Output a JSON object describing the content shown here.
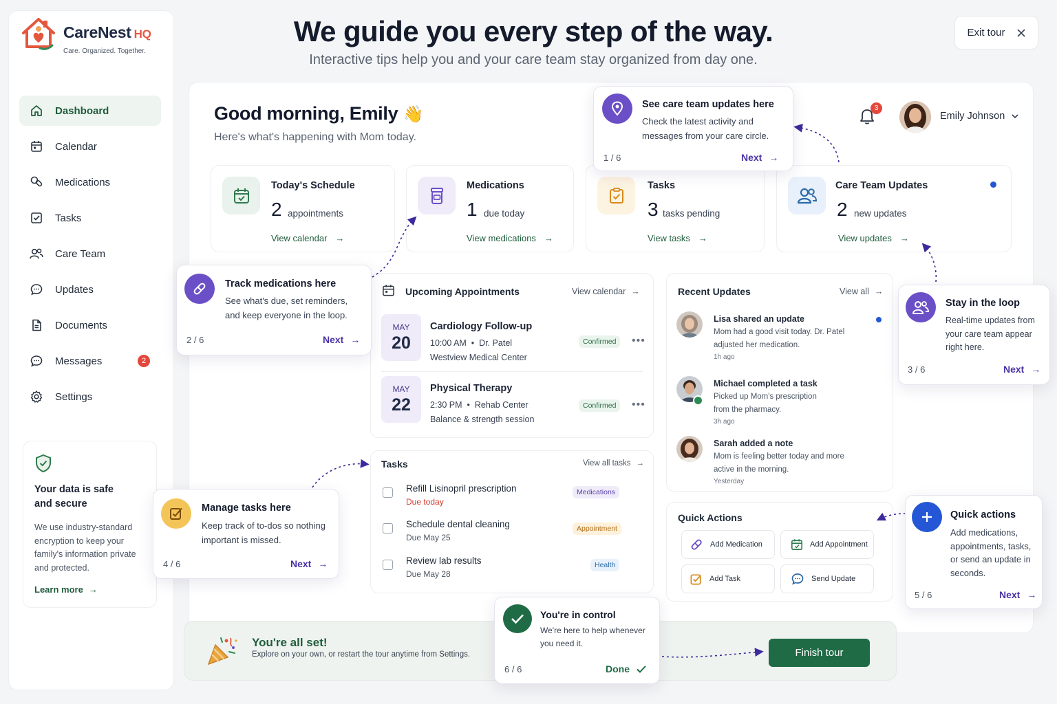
{
  "brand": {
    "name": "CareNest",
    "suffix": "HQ",
    "tagline": "Care. Organized. Together."
  },
  "nav": [
    {
      "label": "Dashboard",
      "icon": "home-icon",
      "active": true
    },
    {
      "label": "Calendar",
      "icon": "calendar-icon"
    },
    {
      "label": "Medications",
      "icon": "pills-icon"
    },
    {
      "label": "Tasks",
      "icon": "checkbox-icon"
    },
    {
      "label": "Care Team",
      "icon": "users-icon"
    },
    {
      "label": "Updates",
      "icon": "chat-icon"
    },
    {
      "label": "Documents",
      "icon": "document-icon"
    },
    {
      "label": "Messages",
      "icon": "message-icon",
      "badge": "2"
    },
    {
      "label": "Settings",
      "icon": "gear-icon"
    }
  ],
  "secure": {
    "title": "Your data is safe and secure",
    "body": "We use industry-standard encryption to keep your family's information private and protected.",
    "link": "Learn more"
  },
  "header": {
    "headline": "We guide you every step of the way.",
    "subhead": "Interactive tips help you and your care team stay organized from day one.",
    "exit": "Exit tour"
  },
  "dashboard": {
    "greeting": "Good morning, Emily",
    "greeting_emoji": "👋",
    "subtitle": "Here's what's happening with Mom today.",
    "notifications": "3",
    "user": "Emily Johnson"
  },
  "stats": [
    {
      "title": "Today's Schedule",
      "count": "2",
      "unit": "appointments",
      "link": "View calendar"
    },
    {
      "title": "Medications",
      "count": "1",
      "unit": "due today",
      "link": "View medications"
    },
    {
      "title": "Tasks",
      "count": "3",
      "unit": "tasks pending",
      "link": "View tasks"
    },
    {
      "title": "Care Team Updates",
      "count": "2",
      "unit": "new updates",
      "link": "View updates"
    }
  ],
  "appointments": {
    "title": "Upcoming Appointments",
    "link": "View calendar",
    "items": [
      {
        "month": "MAY",
        "day": "20",
        "title": "Cardiology Follow-up",
        "time": "10:00 AM",
        "doctor": "Dr. Patel",
        "location": "Westview Medical Center",
        "status": "Confirmed"
      },
      {
        "month": "MAY",
        "day": "22",
        "title": "Physical Therapy",
        "time": "2:30 PM",
        "doctor": "Rehab Center",
        "location": "Balance & strength session",
        "status": "Confirmed"
      }
    ]
  },
  "tasks": {
    "title": "Tasks",
    "link": "View all tasks",
    "items": [
      {
        "title": "Refill Lisinopril prescription",
        "due": "Due today",
        "tag": "Medications"
      },
      {
        "title": "Schedule dental cleaning",
        "due": "Due May 25",
        "tag": "Appointment"
      },
      {
        "title": "Review lab results",
        "due": "Due May 28",
        "tag": "Health"
      }
    ]
  },
  "updates": {
    "title": "Recent Updates",
    "link": "View all",
    "items": [
      {
        "title": "Lisa shared an update",
        "body": "Mom had a good visit today. Dr. Patel adjusted her medication.",
        "time": "1h ago"
      },
      {
        "title": "Michael completed a task",
        "body": "Picked up Mom's prescription from the pharmacy.",
        "time": "3h ago"
      },
      {
        "title": "Sarah added a note",
        "body": "Mom is feeling better today and more active in the morning.",
        "time": "Yesterday"
      }
    ]
  },
  "quick_actions": {
    "title": "Quick Actions",
    "items": [
      "Add Medication",
      "Add Appointment",
      "Add Task",
      "Send Update"
    ]
  },
  "tips": [
    {
      "title": "See care team updates here",
      "body": "Check the latest activity and messages from your care circle.",
      "step": "1 / 6",
      "action": "Next"
    },
    {
      "title": "Track medications here",
      "body": "See what's due, set reminders, and keep everyone in the loop.",
      "step": "2 / 6",
      "action": "Next"
    },
    {
      "title": "Stay in the loop",
      "body": "Real-time updates from your care team appear right here.",
      "step": "3 / 6",
      "action": "Next"
    },
    {
      "title": "Manage tasks here",
      "body": "Keep track of to-dos so nothing important is missed.",
      "step": "4 / 6",
      "action": "Next"
    },
    {
      "title": "Quick actions",
      "body": "Add medications, appointments, tasks, or send an update in seconds.",
      "step": "5 / 6",
      "action": "Next"
    },
    {
      "title": "You're in control",
      "body": "We're here to help whenever you need it.",
      "step": "6 / 6",
      "action": "Done"
    }
  ],
  "banner": {
    "title": "You're all set!",
    "body": "Explore on your own, or restart the tour anytime from Settings.",
    "button": "Finish tour"
  },
  "colors": {
    "accent_green": "#1f6b45",
    "accent_purple": "#6a4fc7",
    "alert_red": "#e4483c"
  }
}
